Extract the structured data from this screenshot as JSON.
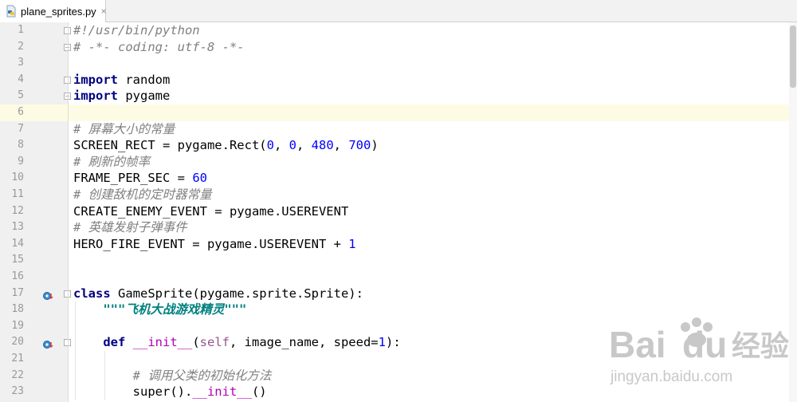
{
  "tab": {
    "filename": "plane_sprites.py",
    "close_glyph": "×",
    "icon": "python-file-icon"
  },
  "editor": {
    "current_line": 6,
    "lines": [
      {
        "n": "1",
        "tokens": [
          {
            "t": "#!/usr/bin/python",
            "c": "cm"
          }
        ]
      },
      {
        "n": "2",
        "tokens": [
          {
            "t": "# -*- coding: utf-8 -*-",
            "c": "cm"
          }
        ]
      },
      {
        "n": "3",
        "tokens": []
      },
      {
        "n": "4",
        "tokens": [
          {
            "t": "import",
            "c": "kw"
          },
          {
            "t": " random",
            "c": ""
          }
        ]
      },
      {
        "n": "5",
        "tokens": [
          {
            "t": "import",
            "c": "kw"
          },
          {
            "t": " pygame",
            "c": ""
          }
        ]
      },
      {
        "n": "6",
        "tokens": []
      },
      {
        "n": "7",
        "tokens": [
          {
            "t": "# 屏幕大小的常量",
            "c": "cm"
          }
        ]
      },
      {
        "n": "8",
        "tokens": [
          {
            "t": "SCREEN_RECT = pygame.Rect(",
            "c": ""
          },
          {
            "t": "0",
            "c": "num"
          },
          {
            "t": ", ",
            "c": ""
          },
          {
            "t": "0",
            "c": "num"
          },
          {
            "t": ", ",
            "c": ""
          },
          {
            "t": "480",
            "c": "num"
          },
          {
            "t": ", ",
            "c": ""
          },
          {
            "t": "700",
            "c": "num"
          },
          {
            "t": ")",
            "c": ""
          }
        ]
      },
      {
        "n": "9",
        "tokens": [
          {
            "t": "# 刷新的帧率",
            "c": "cm"
          }
        ]
      },
      {
        "n": "10",
        "tokens": [
          {
            "t": "FRAME_PER_SEC = ",
            "c": ""
          },
          {
            "t": "60",
            "c": "num"
          }
        ]
      },
      {
        "n": "11",
        "tokens": [
          {
            "t": "# 创建敌机的定时器常量",
            "c": "cm"
          }
        ]
      },
      {
        "n": "12",
        "tokens": [
          {
            "t": "CREATE_ENEMY_EVENT = pygame.USEREVENT",
            "c": ""
          }
        ]
      },
      {
        "n": "13",
        "tokens": [
          {
            "t": "# 英雄发射子弹事件",
            "c": "cm"
          }
        ]
      },
      {
        "n": "14",
        "tokens": [
          {
            "t": "HERO_FIRE_EVENT = pygame.USEREVENT + ",
            "c": ""
          },
          {
            "t": "1",
            "c": "num"
          }
        ]
      },
      {
        "n": "15",
        "tokens": []
      },
      {
        "n": "16",
        "tokens": []
      },
      {
        "n": "17",
        "tokens": [
          {
            "t": "class",
            "c": "kw"
          },
          {
            "t": " GameSprite(pygame.sprite.Sprite):",
            "c": ""
          }
        ]
      },
      {
        "n": "18",
        "tokens": [
          {
            "t": "    ",
            "c": ""
          },
          {
            "t": "\"\"\"飞机大战游戏精灵\"\"\"",
            "c": "str"
          }
        ]
      },
      {
        "n": "19",
        "tokens": []
      },
      {
        "n": "20",
        "tokens": [
          {
            "t": "    ",
            "c": ""
          },
          {
            "t": "def",
            "c": "kw"
          },
          {
            "t": " ",
            "c": ""
          },
          {
            "t": "__init__",
            "c": "magic"
          },
          {
            "t": "(",
            "c": ""
          },
          {
            "t": "self",
            "c": "self"
          },
          {
            "t": ", image_name, speed=",
            "c": ""
          },
          {
            "t": "1",
            "c": "num"
          },
          {
            "t": "):",
            "c": ""
          }
        ]
      },
      {
        "n": "21",
        "tokens": []
      },
      {
        "n": "22",
        "tokens": [
          {
            "t": "        ",
            "c": ""
          },
          {
            "t": "# 调用父类的初始化方法",
            "c": "cm"
          }
        ]
      },
      {
        "n": "23",
        "tokens": [
          {
            "t": "        super().",
            "c": ""
          },
          {
            "t": "__init__",
            "c": "magic"
          },
          {
            "t": "()",
            "c": ""
          }
        ]
      }
    ]
  },
  "gutter": {
    "fold_lines": [
      1,
      2,
      4,
      5,
      17,
      20
    ],
    "fold_end_lines": [
      2,
      5
    ],
    "override_marker_lines": [
      17,
      20
    ],
    "override_marker_icon": "override-arrow-icon"
  },
  "watermark": {
    "logo_text": "Bai",
    "logo_text_2": "du",
    "cn_text": "经验",
    "url": "jingyan.baidu.com",
    "icon": "baidu-paw-icon"
  },
  "colors": {
    "keyword": "#000080",
    "comment": "#808080",
    "number": "#0000ff",
    "docstring": "#008080",
    "self": "#94558d",
    "magic": "#b200b2",
    "current_line_bg": "#fdfbe4",
    "gutter_bg": "#f0f0f0"
  }
}
